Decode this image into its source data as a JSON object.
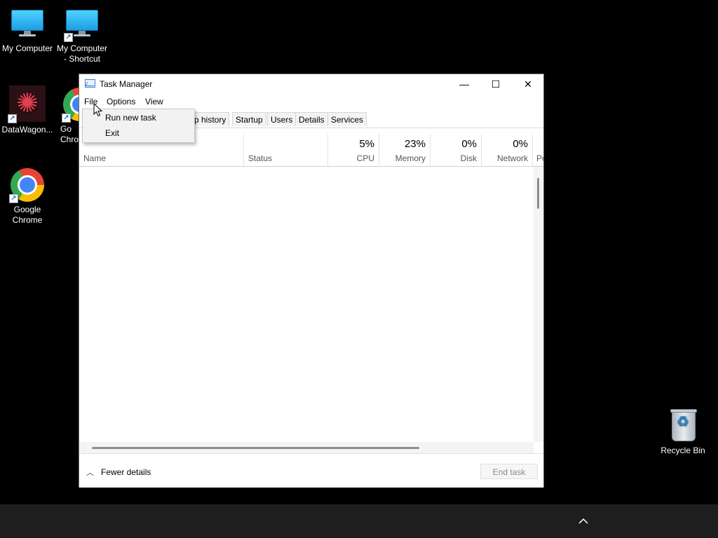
{
  "desktop": {
    "icons": [
      {
        "label": "My Computer",
        "icon": "monitor-icon"
      },
      {
        "label": "My Computer - Shortcut",
        "icon": "monitor-icon"
      },
      {
        "label": "DataWagon...",
        "icon": "datawagon-icon"
      },
      {
        "label": "Go Chro",
        "icon": "chrome-icon"
      },
      {
        "label": "Google Chrome",
        "icon": "chrome-icon"
      },
      {
        "label": "Recycle Bin",
        "icon": "recycle-bin-icon"
      }
    ]
  },
  "window": {
    "title": "Task Manager",
    "controls": {
      "minimize": "—",
      "maximize": "☐",
      "close": "✕"
    }
  },
  "menubar": [
    "File",
    "Options",
    "View"
  ],
  "file_menu": {
    "items": [
      "Run new task",
      "Exit"
    ]
  },
  "tabs": [
    "p history",
    "Startup",
    "Users",
    "Details",
    "Services"
  ],
  "columns": {
    "name": "Name",
    "status": "Status",
    "cpu": {
      "value": "5%",
      "label": "CPU"
    },
    "memory": {
      "value": "23%",
      "label": "Memory"
    },
    "disk": {
      "value": "0%",
      "label": "Disk"
    },
    "network": {
      "value": "0%",
      "label": "Network"
    },
    "power": "Po"
  },
  "footer": {
    "fewer_details": "Fewer details",
    "end_task": "End task"
  },
  "taskbar": {
    "tray_chevron": "^"
  }
}
